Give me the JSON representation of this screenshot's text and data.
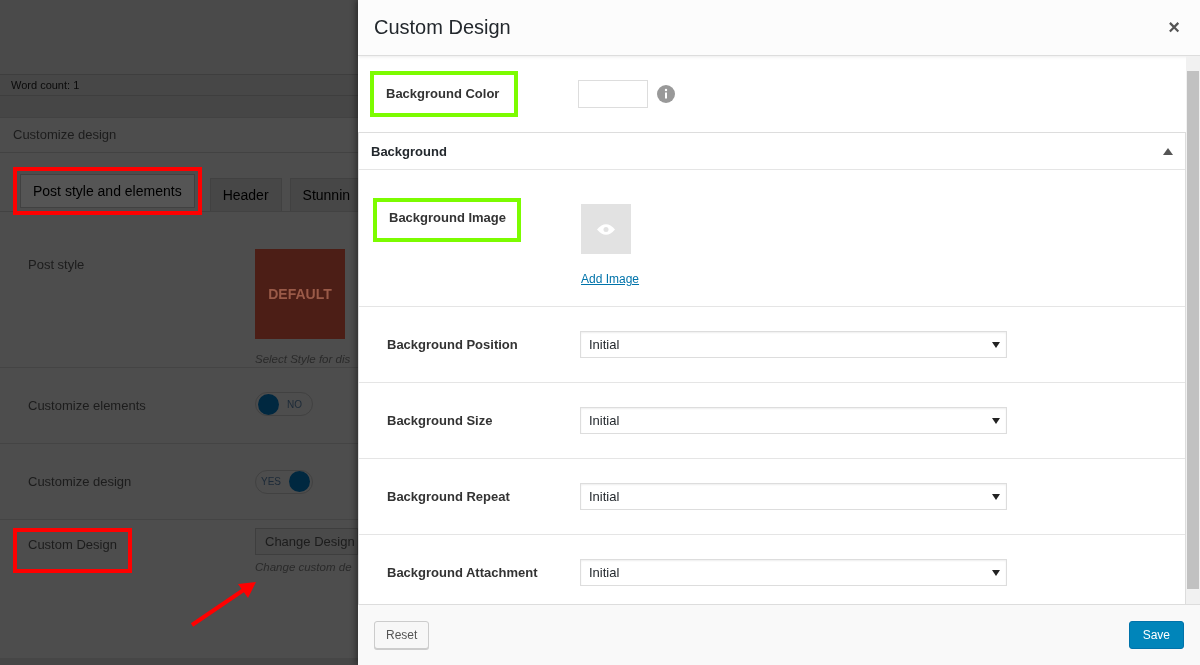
{
  "page": {
    "word_count": "Word count: 1",
    "panel_title": "Customize design",
    "tabs": [
      {
        "label": "Post style and elements",
        "selected": true,
        "annotated": true
      },
      {
        "label": "Header",
        "selected": false,
        "annotated": false
      },
      {
        "label": "Stunnin",
        "selected": false,
        "annotated": false
      }
    ],
    "settings": [
      {
        "kind": "style",
        "label": "Post style",
        "annotated": false,
        "thumbnail_text": "DEFAULT",
        "description": "Select Style for dis"
      },
      {
        "kind": "toggle",
        "label": "Customize elements",
        "annotated": false,
        "on": false,
        "toggle_text": "NO"
      },
      {
        "kind": "toggle",
        "label": "Customize design",
        "annotated": false,
        "on": true,
        "toggle_text": "YES"
      },
      {
        "kind": "button",
        "label": "Custom Design",
        "annotated": true,
        "button": "Change Design",
        "description": "Change custom de"
      }
    ]
  },
  "dialog": {
    "title": "Custom Design",
    "close": "×",
    "color_field": {
      "label": "Background Color",
      "annotated": true
    },
    "section": {
      "title": "Background",
      "expanded": true,
      "image": {
        "label": "Background Image",
        "annotated": true,
        "link": "Add Image"
      },
      "selects": [
        {
          "label": "Background Position",
          "value": "Initial"
        },
        {
          "label": "Background Size",
          "value": "Initial"
        },
        {
          "label": "Background Repeat",
          "value": "Initial"
        },
        {
          "label": "Background Attachment",
          "value": "Initial"
        }
      ]
    },
    "buttons": [
      {
        "label": "Reset",
        "kind": "secondary"
      },
      {
        "label": "Save",
        "kind": "primary"
      }
    ]
  }
}
